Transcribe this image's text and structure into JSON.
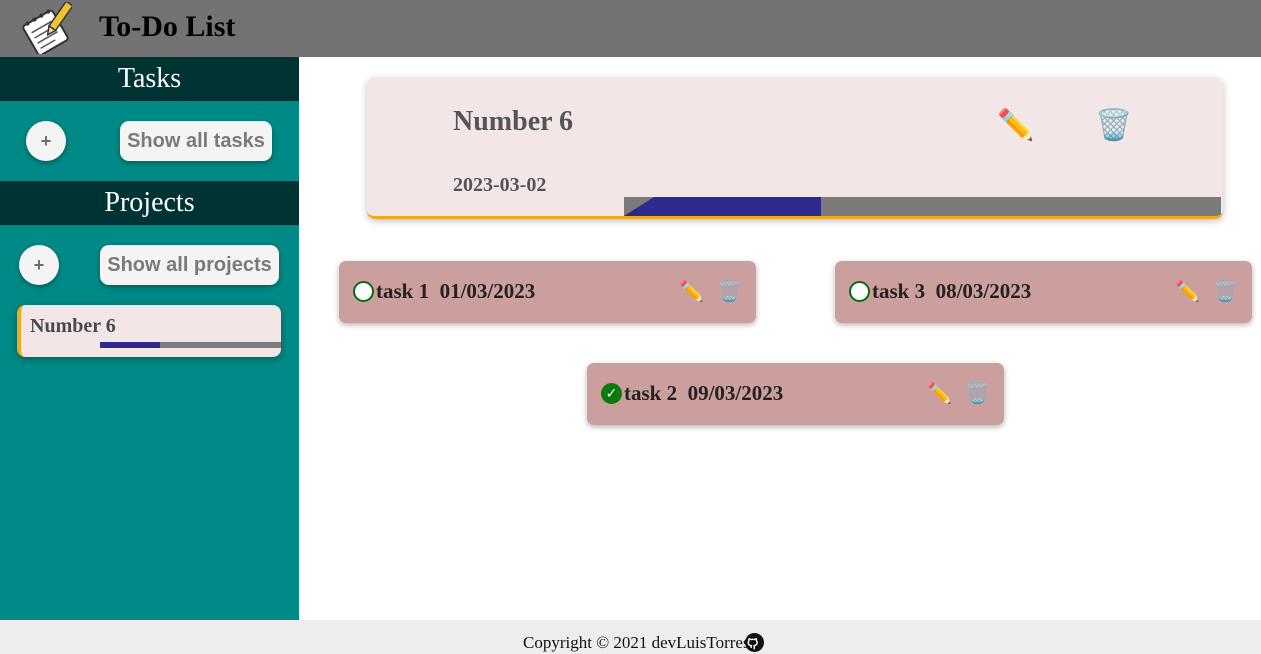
{
  "header": {
    "title": "To-Do List",
    "logo_icon": "notepad-pencil-icon"
  },
  "sidebar": {
    "tasks_heading": "Tasks",
    "add_task_label": "+",
    "show_all_tasks_label": "Show all tasks",
    "projects_heading": "Projects",
    "add_project_label": "+",
    "show_all_projects_label": "Show all projects",
    "projects": [
      {
        "name": "Number 6",
        "progress": 0.33
      }
    ]
  },
  "project": {
    "title": "Number 6",
    "date": "2023-03-02",
    "edit_icon": "pencil-icon",
    "delete_icon": "wastebasket-icon",
    "progress": 0.33
  },
  "tasks": [
    {
      "name": "task 1",
      "date": "01/03/2023",
      "done": false,
      "display": "task 1  01/03/2023"
    },
    {
      "name": "task 3",
      "date": "08/03/2023",
      "done": false,
      "display": "task 3  08/03/2023"
    },
    {
      "name": "task 2",
      "date": "09/03/2023",
      "done": true,
      "display": "task 2  09/03/2023"
    }
  ],
  "footer": {
    "copyright": "Copyright © 2021 devLuisTorres",
    "github_icon": "github-icon"
  },
  "colors": {
    "header_bg": "#737373",
    "sidebar_bg": "#008a87",
    "sidebar_heading_bg": "#003334",
    "card_bg": "#f3e6e6",
    "task_bg": "#cc9f9f",
    "accent": "#f2a91b",
    "progress_fill": "#2c2a8f",
    "progress_track": "#7b7b7b",
    "done_green": "#0b7a0b"
  }
}
